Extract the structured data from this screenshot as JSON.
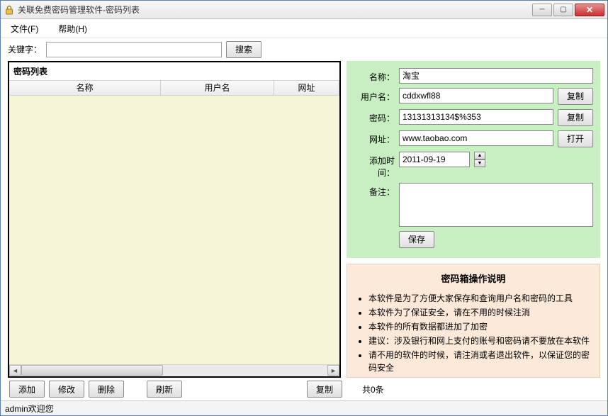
{
  "title": "关联免费密码管理软件-密码列表",
  "menu": {
    "file": "文件(F)",
    "help": "帮助(H)"
  },
  "search": {
    "label": "关键字：",
    "value": "",
    "button": "搜索"
  },
  "list": {
    "header": "密码列表",
    "cols": {
      "name": "名称",
      "user": "用户名",
      "url": "网址"
    }
  },
  "buttons": {
    "add": "添加",
    "edit": "修改",
    "delete": "删除",
    "refresh": "刷新",
    "copy": "复制",
    "copy1": "复制",
    "copy2": "复制",
    "open": "打开",
    "save": "保存"
  },
  "count": "共0条",
  "detail": {
    "labels": {
      "name": "名称：",
      "user": "用户名：",
      "password": "密码：",
      "url": "网址：",
      "date": "添加时间：",
      "note": "备注："
    },
    "values": {
      "name": "淘宝",
      "user": "cddxwfl88",
      "password": "13131313134$%353",
      "url": "www.taobao.com",
      "date": "2011-09-19",
      "note": ""
    }
  },
  "instructions": {
    "title": "密码箱操作说明",
    "items": [
      "本软件是为了方便大家保存和查询用户名和密码的工具",
      "本软件为了保证安全，请在不用的时候注消",
      "本软件的所有数据都进加了加密",
      "建议：涉及银行和网上支付的账号和密码请不要放在本软件",
      "请不用的软件的时候，请注消或者退出软件，以保证您的密码安全"
    ]
  },
  "status": "admin欢迎您"
}
